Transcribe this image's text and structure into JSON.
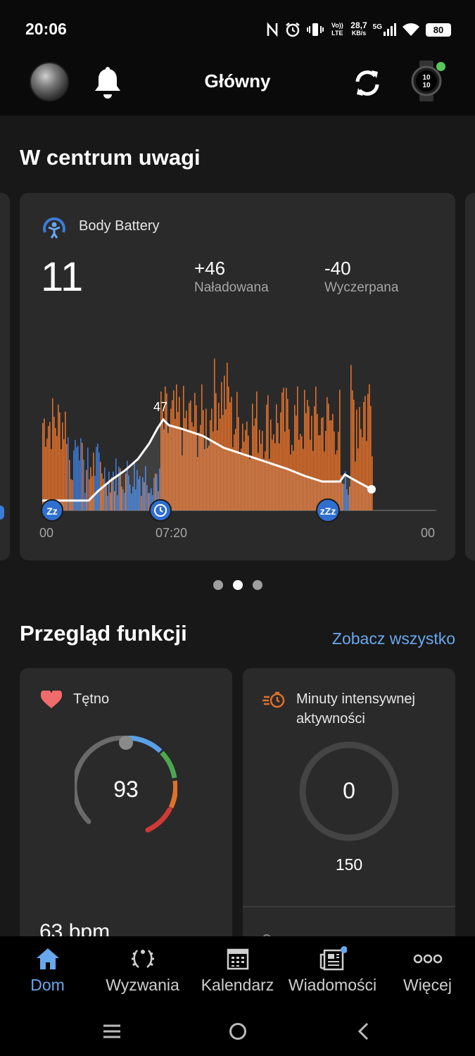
{
  "status": {
    "time": "20:06",
    "volte": "Vo)) LTE",
    "speed_value": "28,7",
    "speed_unit": "KB/s",
    "network": "5G",
    "battery": "80"
  },
  "header": {
    "title": "Główny"
  },
  "spotlight": {
    "title": "W centrum uwagi",
    "card": {
      "name": "Body Battery",
      "value": "11",
      "charged_value": "+46",
      "charged_label": "Naładowana",
      "drained_value": "-40",
      "drained_label": "Wyczerpana",
      "peak_label": "47",
      "time_start": "00",
      "time_mid": "07:20",
      "time_end": "00"
    },
    "pager_active_index": 1
  },
  "overview": {
    "title": "Przegląd funkcji",
    "see_all": "Zobacz wszystko",
    "heart_rate": {
      "title": "Tętno",
      "value": "93",
      "resting": "63 bpm"
    },
    "intensity": {
      "title_line1": "Minuty intensywnej",
      "title_line2": "aktywności",
      "value": "0",
      "goal": "150"
    }
  },
  "nav": {
    "items": [
      {
        "label": "Dom"
      },
      {
        "label": "Wyzwania"
      },
      {
        "label": "Kalendarz"
      },
      {
        "label": "Wiadomości"
      },
      {
        "label": "Więcej"
      }
    ]
  },
  "colors": {
    "accent": "#68a7ee",
    "stress_high": "#e0702c",
    "rest": "#3d7bd6",
    "heart": "#f06b6b",
    "online": "#58c75b"
  }
}
